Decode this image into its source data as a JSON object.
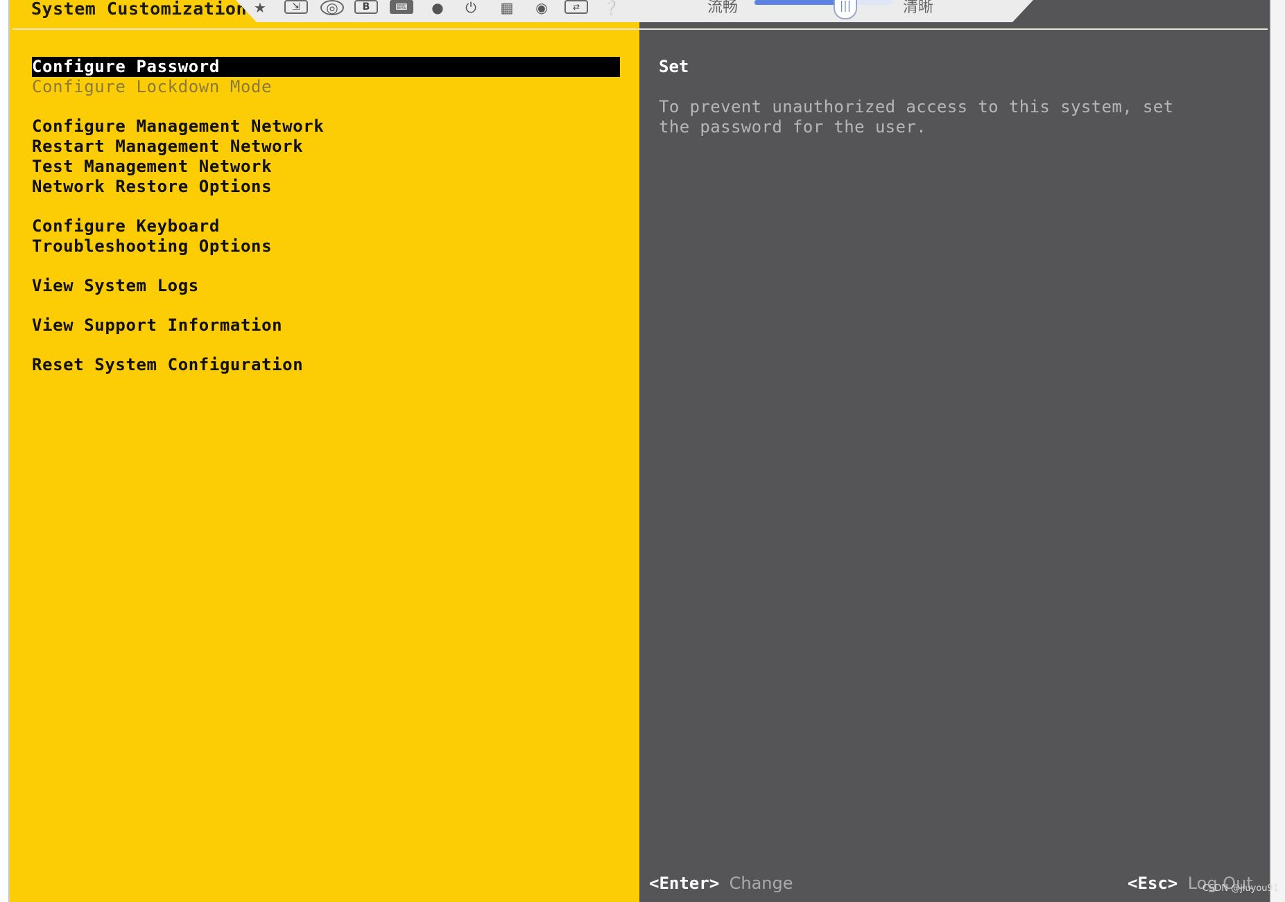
{
  "header": {
    "title": "System Customization"
  },
  "toolbar": {
    "icons": [
      "pin-icon",
      "fit-window-icon",
      "target-icon",
      "b-icon",
      "keyboard-icon",
      "snapshot-icon",
      "power-icon",
      "save-icon",
      "record-icon",
      "keyboard-layout-icon",
      "help-icon"
    ],
    "quality_low_label": "流畅",
    "quality_high_label": "清晰"
  },
  "menu": {
    "items": [
      {
        "label": "Configure Password",
        "state": "selected"
      },
      {
        "label": "Configure Lockdown Mode",
        "state": "disabled"
      },
      {
        "label": "Configure Management Network"
      },
      {
        "label": "Restart Management Network"
      },
      {
        "label": "Test Management Network"
      },
      {
        "label": "Network Restore Options"
      },
      {
        "label": "Configure Keyboard"
      },
      {
        "label": "Troubleshooting Options"
      },
      {
        "label": "View System Logs"
      },
      {
        "label": "View Support Information"
      },
      {
        "label": "Reset System Configuration"
      }
    ]
  },
  "detail": {
    "title": "Set",
    "description": "To prevent unauthorized access to this system, set the password for the user."
  },
  "footer": {
    "enter_key": "<Enter>",
    "enter_action": "Change",
    "esc_key": "<Esc>",
    "esc_action": "Log Out"
  },
  "watermark": "CSDN @jiuyou91",
  "colors": {
    "left_panel": "#fccd04",
    "right_panel": "#555557",
    "selected_bg": "#000000"
  }
}
